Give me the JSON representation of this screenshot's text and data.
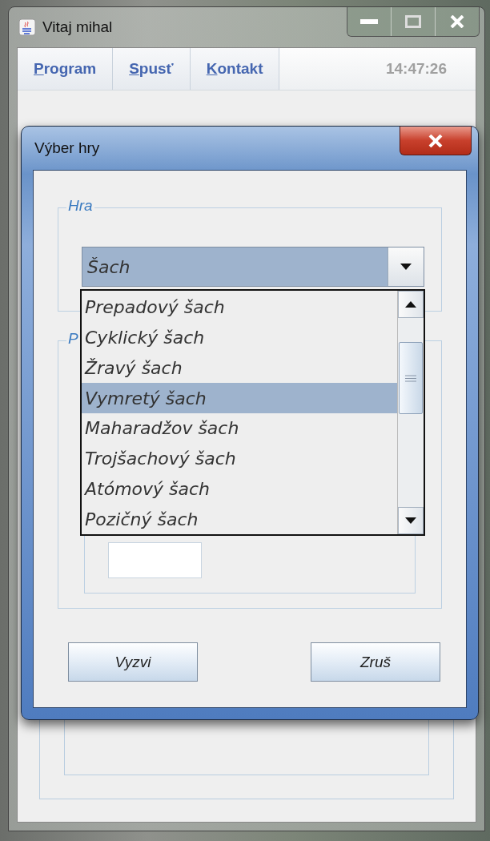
{
  "main_window": {
    "title": "Vitaj mihal",
    "menu": [
      {
        "label": "Program"
      },
      {
        "label": "Spusť"
      },
      {
        "label": "Kontakt"
      }
    ],
    "clock": "14:47:26"
  },
  "dialog": {
    "title": "Výber hry",
    "game_group": {
      "legend": "Hra",
      "combo": {
        "value": "Šach",
        "expanded": true,
        "options": [
          {
            "label": "Prepadový šach",
            "selected": false
          },
          {
            "label": "Cyklický šach",
            "selected": false
          },
          {
            "label": "Žravý šach",
            "selected": false
          },
          {
            "label": "Vymretý šach",
            "selected": true
          },
          {
            "label": "Maharadžov šach",
            "selected": false
          },
          {
            "label": "Trojšachový šach",
            "selected": false
          },
          {
            "label": "Atómový šach",
            "selected": false
          },
          {
            "label": "Pozičný šach",
            "selected": false
          }
        ]
      }
    },
    "second_group": {
      "legend": "P"
    },
    "buttons": [
      {
        "label": "Vyzvi"
      },
      {
        "label": "Zruš"
      }
    ]
  }
}
